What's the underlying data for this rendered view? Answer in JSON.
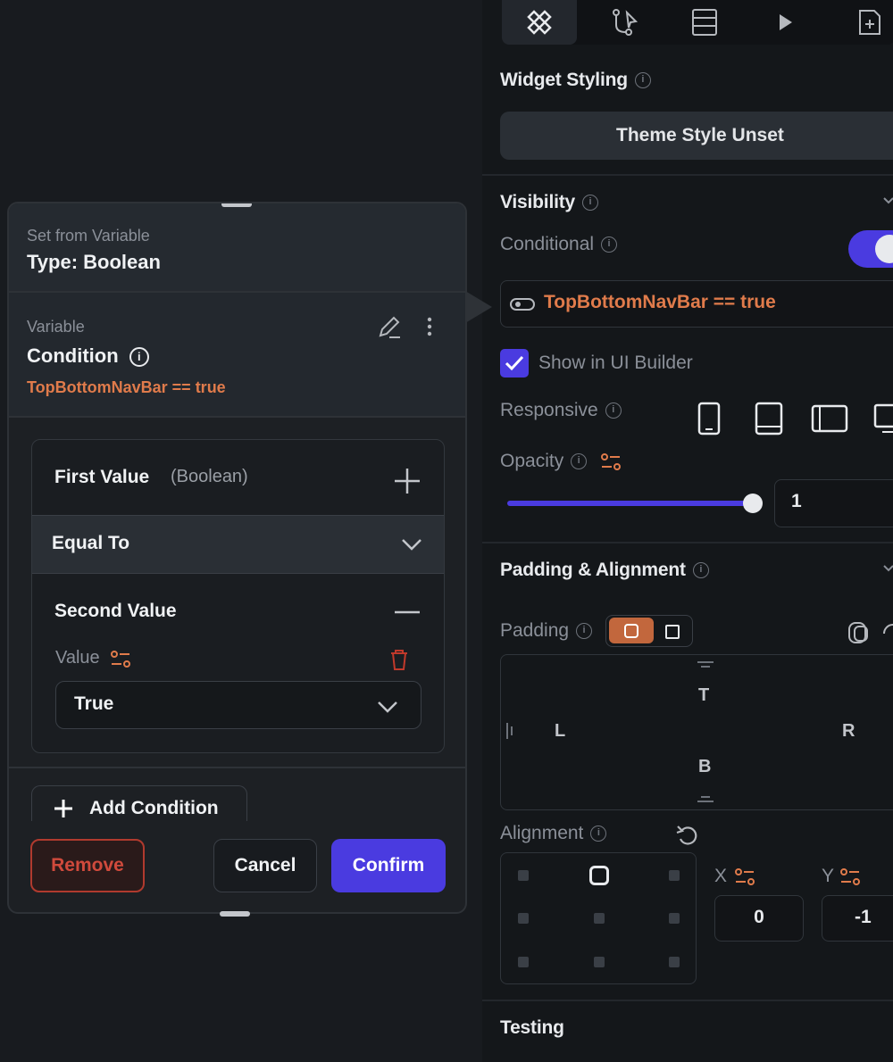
{
  "right_panel": {
    "tabs": [
      "properties",
      "actions",
      "backend",
      "preview",
      "documentation"
    ],
    "widget_styling": {
      "title": "Widget Styling",
      "theme_button": "Theme Style Unset"
    },
    "visibility": {
      "title": "Visibility",
      "conditional_label": "Conditional",
      "conditional_on": true,
      "condition_text": "TopBottomNavBar == true",
      "show_in_builder_label": "Show in UI Builder",
      "show_in_builder_checked": true,
      "responsive_label": "Responsive",
      "opacity_label": "Opacity",
      "opacity_value": "1",
      "opacity_level": 1.0
    },
    "padding_alignment": {
      "title": "Padding & Alignment",
      "padding_label": "Padding",
      "pad_top": "T",
      "pad_left": "L",
      "pad_right": "R",
      "pad_bottom": "B",
      "alignment_label": "Alignment",
      "x_label": "X",
      "y_label": "Y",
      "x_value": "0",
      "y_value": "-1"
    },
    "testing": {
      "title": "Testing"
    }
  },
  "popup": {
    "subtitle": "Set from Variable",
    "type_label": "Type: Boolean",
    "variable_label": "Variable",
    "condition_title": "Condition",
    "condition_expr": "TopBottomNavBar == true",
    "first_value_label": "First Value",
    "first_value_type": "(Boolean)",
    "operator": "Equal To",
    "second_value_label": "Second Value",
    "value_label": "Value",
    "value_selected": "True",
    "add_condition": "Add Condition",
    "remove": "Remove",
    "cancel": "Cancel",
    "confirm": "Confirm"
  },
  "colors": {
    "accent": "#4a3be0",
    "orange": "#e07b4b",
    "danger": "#c0392b"
  }
}
